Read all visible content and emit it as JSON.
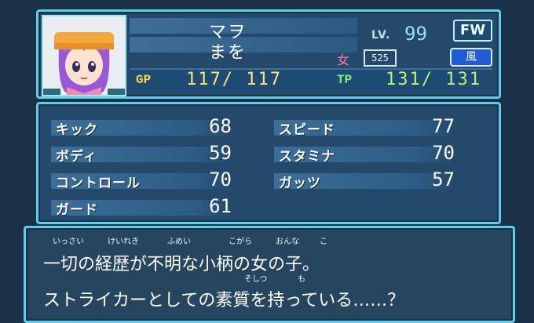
{
  "player": {
    "name_katakana": "マヲ",
    "name_hiragana": "まを",
    "level_label": "LV.",
    "level": "99",
    "position": "FW",
    "gender": "女",
    "number": "525",
    "element": "風"
  },
  "gauges": {
    "gp_label": "GP",
    "gp_value": "117/ 117",
    "tp_label": "TP",
    "tp_value": "131/ 131"
  },
  "stats": {
    "kick": {
      "label": "キック",
      "value": "68"
    },
    "body": {
      "label": "ボディ",
      "value": "59"
    },
    "control": {
      "label": "コントロール",
      "value": "70"
    },
    "guard": {
      "label": "ガード",
      "value": "61"
    },
    "speed": {
      "label": "スピード",
      "value": "77"
    },
    "stamina": {
      "label": "スタミナ",
      "value": "70"
    },
    "guts": {
      "label": "ガッツ",
      "value": "57"
    }
  },
  "description": {
    "line1": "一切の経歴が不明な小柄の女の子。",
    "line2": "ストライカーとしての素質を持っている……？",
    "ruby": {
      "r1": "いっさい",
      "r2": "けいれき",
      "r3": "ふめい",
      "r4": "こがら",
      "r5": "おんな",
      "r6": "こ",
      "r7": "そしつ",
      "r8": "も"
    }
  },
  "colors": {
    "frame": "#5dd0e8",
    "gp": "#ffd24a",
    "tp": "#7ff07a",
    "element_badge": "#1f5bd6"
  }
}
